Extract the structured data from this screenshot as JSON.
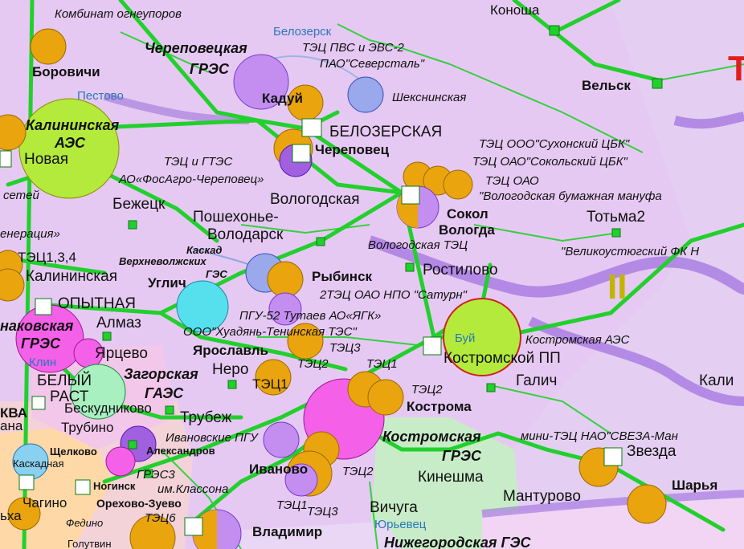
{
  "map": {
    "labels": {
      "kombinat": "Комбинат огнеупоров",
      "borovichi": "Боровичи",
      "cherepovets_gres_1": "Череповецкая",
      "cherepovets_gres_2": "ГРЭС",
      "belozersk": "Белозерск",
      "tec_pvs": "ТЭЦ ПВС и ЭВС-2",
      "severstal": "ПАО\"Северсталь\"",
      "konosha": "Коноша",
      "velsk": "Вельск",
      "pestovo": "Пестово",
      "kaduy": "Кадуй",
      "sheksninskaya": "Шекснинская",
      "kalininskaya_aes_1": "Калининская",
      "kalininskaya_aes_2": "АЭС",
      "novaya": "Новая",
      "belozerskaya": "БЕЛОЗЕРСКАЯ",
      "cherepovets": "Череповец",
      "tec_sukhonsky": "ТЭЦ ООО\"Сухонский ЦБК\"",
      "tec_sokolsky": "ТЭЦ ОАО\"Сокольский ЦБК\"",
      "tec_oao": "ТЭЦ ОАО",
      "vologda_paper": "\"Вологодская бумажная мануфа",
      "tec_i_gtes": "ТЭЦ и ГТЭС",
      "fosagro": "АО«ФосАгро-Череповец»",
      "setey": "сетей",
      "vologodskaya": "Вологодская",
      "sokol": "Сокол",
      "vologda": "Вологда",
      "bezhetsk": "Бежецк",
      "poshekhonye_1": "Пошехонье-",
      "poshekhonye_2": "Володарск",
      "totma": "Тотьма2",
      "generatsiya": "енерация»",
      "vologda_tec": "Вологодская ТЭЦ",
      "velikoustyug": "\"Великоустюгский ФК Н",
      "kaskad_1": "Каскад",
      "kaskad_2": "Верхневолжских",
      "kaskad_3": "ГЭС",
      "tec134": "ТЭЦ1,3,4",
      "rostilovo": "Ростилово",
      "rybinsk": "Рыбинск",
      "kalininskaya": "Калининская",
      "saturn": "2ТЭЦ ОАО НПО \"Сатурн\"",
      "uglich": "Углич",
      "roman_ii": "II",
      "opytnaya": "ОПЫТНАЯ",
      "pgu52": "ПГУ-52 Тутаев АО«ЯГК»",
      "konakovskaya_1": "наковская",
      "konakovskaya_2": "ГРЭС",
      "almaz": "Алмаз",
      "huadyan": "ООО\"Хуадянь-Тенинская ТЭС\"",
      "buy": "Буй",
      "kostroma_aes": "Костромская АЭС",
      "tec3_yar": "ТЭЦ3",
      "yartsevo": "Ярцево",
      "yaroslavl": "Ярославль",
      "kostromskoy_pp": "Костромской ПП",
      "klin": "Клин",
      "tec2_yar": "ТЭЦ2",
      "tec1_yar": "ТЭЦ1",
      "kali": "Кали",
      "nero": "Неро",
      "galich": "Галич",
      "zagorskaya_1": "Загорская",
      "belyy_1": "БЕЛЫЙ",
      "tec1_nero": "ТЭЦ1",
      "tec2_kos": "ТЭЦ2",
      "rast": "РАСТ",
      "zagorskaya_2": "ГАЭС",
      "kostroma": "Кострома",
      "kva": "КВА",
      "beskudnikovo": "Бескудниково",
      "trubezh": "Трубеж",
      "kostromskaya_gres_1": "Костромская",
      "sveza": "мини-ТЭЦ НАО\"СВЕЗА-Ман",
      "ana": "ана",
      "trubino": "Трубино",
      "ivanovskie_pgu": "Ивановские ПГУ",
      "zvezda": "Звезда",
      "shchelkovo": "Щелково",
      "aleksandrov": "Александров",
      "kostromskaya_gres_2": "ГРЭС",
      "kaskadnaya": "Каскадная",
      "ivanovo": "Иваново",
      "tec2_iv": "ТЭЦ2",
      "kineshma": "Кинешма",
      "sharya": "Шарья",
      "gres3": "ГРЭС3",
      "klassona": "им.Классона",
      "noginsk": "Ногинск",
      "manturovo": "Мантурово",
      "chagino": "Чагино",
      "orekhovo": "Орехово-Зуево",
      "tec1_iv": "ТЭЦ1",
      "tec3_iv": "ТЭЦ3",
      "vichuga": "Вичуга",
      "ikha": "ьха",
      "tec6": "ТЭЦ6",
      "fedino": "Федино",
      "yuryevets": "Юрьевец",
      "vladimir": "Владимир",
      "nizhegorodskaya": "Нижегородская ГЭС",
      "golutvin": "Голутвин",
      "red_t": "Т"
    }
  }
}
